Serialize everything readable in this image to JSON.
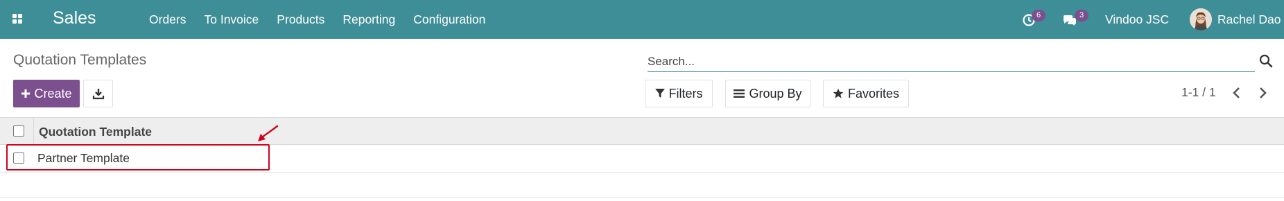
{
  "navbar": {
    "app_name": "Sales",
    "menu": [
      "Orders",
      "To Invoice",
      "Products",
      "Reporting",
      "Configuration"
    ],
    "activity_count": "6",
    "message_count": "3",
    "company": "Vindoo JSC",
    "user": "Rachel Dao",
    "accent_color": "#3e8e97"
  },
  "control_panel": {
    "breadcrumb": "Quotation Templates",
    "search_placeholder": "Search...",
    "create_label": "Create",
    "filters_label": "Filters",
    "group_by_label": "Group By",
    "favorites_label": "Favorites",
    "pager": "1-1 / 1",
    "primary_color": "#7c4f8f"
  },
  "table": {
    "columns": [
      "Quotation Template"
    ],
    "rows": [
      [
        "Partner Template"
      ]
    ]
  },
  "annotation": {
    "color": "#d0021b"
  }
}
